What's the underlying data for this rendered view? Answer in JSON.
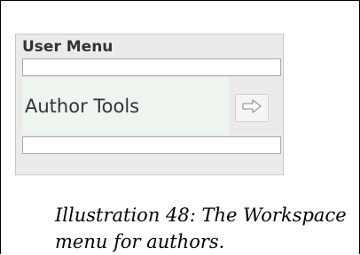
{
  "user_menu": {
    "title": "User Menu",
    "author_tools_label": "Author Tools",
    "go_icon": "arrow-right-icon"
  },
  "caption": {
    "text": "Illustration 48: The Workspace menu for authors."
  },
  "colors": {
    "panel_bg": "#ebebeb",
    "author_row_bg": "#eef5ee",
    "title_text": "#333333"
  }
}
